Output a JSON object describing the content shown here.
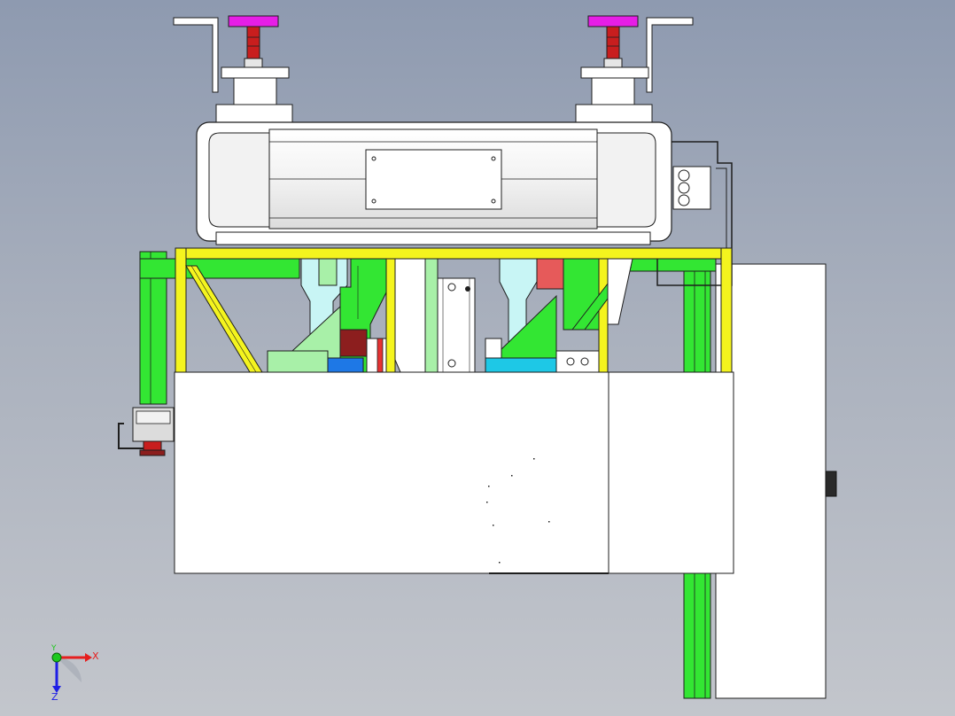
{
  "viewport": {
    "background_top": "#8e9ab0",
    "background_bottom": "#c3c6cc"
  },
  "colors": {
    "frame_green": "#33e633",
    "frame_yellow": "#f4f41e",
    "handle_magenta": "#e61ee6",
    "stem_red": "#c81e1e",
    "light_green": "#a8f0a8",
    "light_cyan": "#c8f5f5",
    "cyan_block": "#1ec8e6",
    "blue_block": "#1e78e6",
    "salmon": "#e65a5a",
    "dark_red": "#8c1e1e",
    "white_part": "#ffffff",
    "light_gray": "#e6e6e6",
    "outline": "#1e1e1e"
  },
  "axis_triad": {
    "x_label": "X",
    "y_label": "Y",
    "z_label": "Z",
    "x_color": "#e61e1e",
    "y_color": "#1ec81e",
    "z_color": "#1e1ee6"
  }
}
